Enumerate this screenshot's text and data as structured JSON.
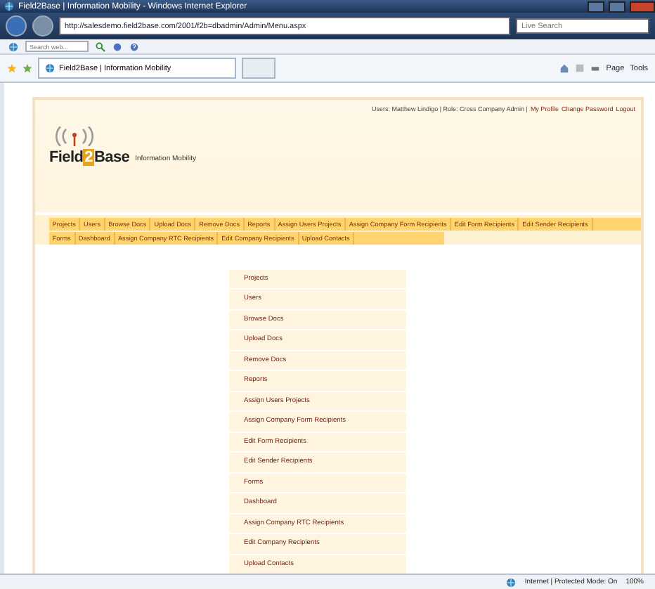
{
  "window": {
    "title": "Field2Base | Information Mobility - Windows Internet Explorer"
  },
  "address_bar": {
    "url": "http://salesdemo.field2base.com/2001/f2b=dbadmin/Admin/Menu.aspx"
  },
  "search_box": {
    "placeholder": "Live Search"
  },
  "toolbar_search": {
    "placeholder": "Search web..."
  },
  "tab": {
    "title": "Field2Base | Information Mobility"
  },
  "command_bar": [
    "Page",
    "Tools"
  ],
  "header": {
    "user_info": "Users: Matthew Lindigo | Role: Cross Company Admin |",
    "links": [
      "My Profile",
      "Change Password",
      "Logout"
    ]
  },
  "logo": {
    "first": "Field",
    "middle": "2",
    "last": "Base",
    "tagline": "Information Mobility"
  },
  "nav_rows": [
    [
      "Projects",
      "Users",
      "Browse Docs",
      "Upload Docs",
      "Remove Docs",
      "Reports",
      "Assign Users Projects",
      "Assign Company Form Recipients",
      "Edit Form Recipients",
      "Edit Sender Recipients"
    ],
    [
      "Forms",
      "Dashboard",
      "Assign Company RTC Recipients",
      "Edit Company Recipients",
      "Upload Contacts"
    ]
  ],
  "menu": [
    "Projects",
    "Users",
    "Browse Docs",
    "Upload Docs",
    "Remove Docs",
    "Reports",
    "Assign Users Projects",
    "Assign Company Form Recipients",
    "Edit Form Recipients",
    "Edit Sender Recipients",
    "Forms",
    "Dashboard",
    "Assign Company RTC Recipients",
    "Edit Company Recipients",
    "Upload Contacts"
  ],
  "status_bar": {
    "zone": "Internet | Protected Mode: On",
    "zoom": "100%"
  }
}
